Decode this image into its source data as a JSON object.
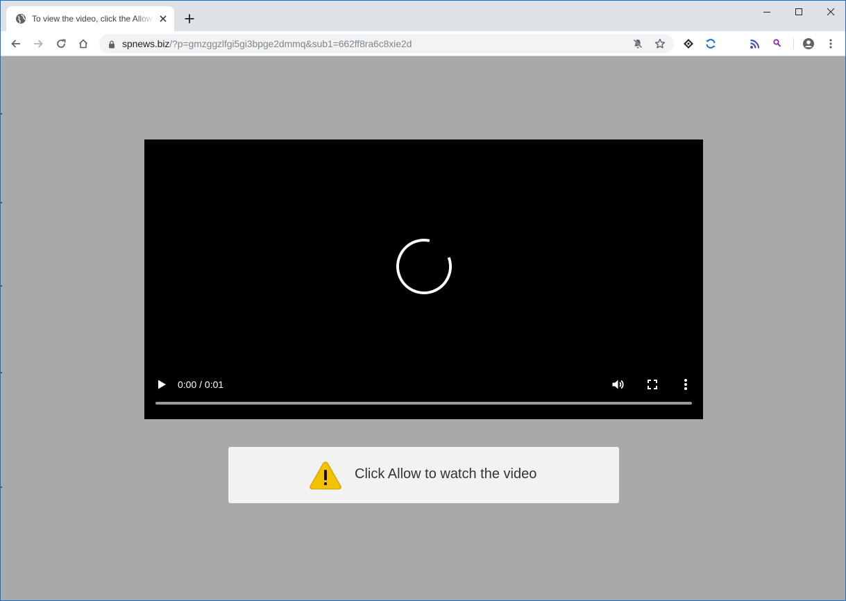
{
  "tab": {
    "title": "To view the video, click the Allow button",
    "favicon": "globe-icon"
  },
  "window_controls": [
    "minimize-icon",
    "maximize-icon",
    "close-icon"
  ],
  "toolbar": {
    "nav_icons": [
      "back-arrow-icon",
      "forward-arrow-icon",
      "reload-icon",
      "home-icon"
    ],
    "url_host": "spnews.biz",
    "url_rest": "/?p=gmzggzlfgi5gi3bpge2dmmq&sub1=662ff8ra6c8xie2d",
    "omnibox_icons": [
      "notifications-blocked-icon",
      "bookmark-star-icon"
    ],
    "extension_icons": [
      "diamond-extension-icon",
      "sync-extension-icon",
      "rss-extension-icon",
      "search-extension-icon"
    ],
    "profile_icon": "account-circle-icon",
    "menu_icon": "kebab-menu-icon",
    "accent_color": "#1a73e8"
  },
  "video_player": {
    "state": "loading",
    "time_display": "0:00 / 0:01",
    "progress": 0.0
  },
  "notice": {
    "icon": "warning-triangle-icon",
    "text": "Click Allow to watch the video",
    "icon_color": "#f2c200"
  },
  "page_background": "#a9a9a9"
}
